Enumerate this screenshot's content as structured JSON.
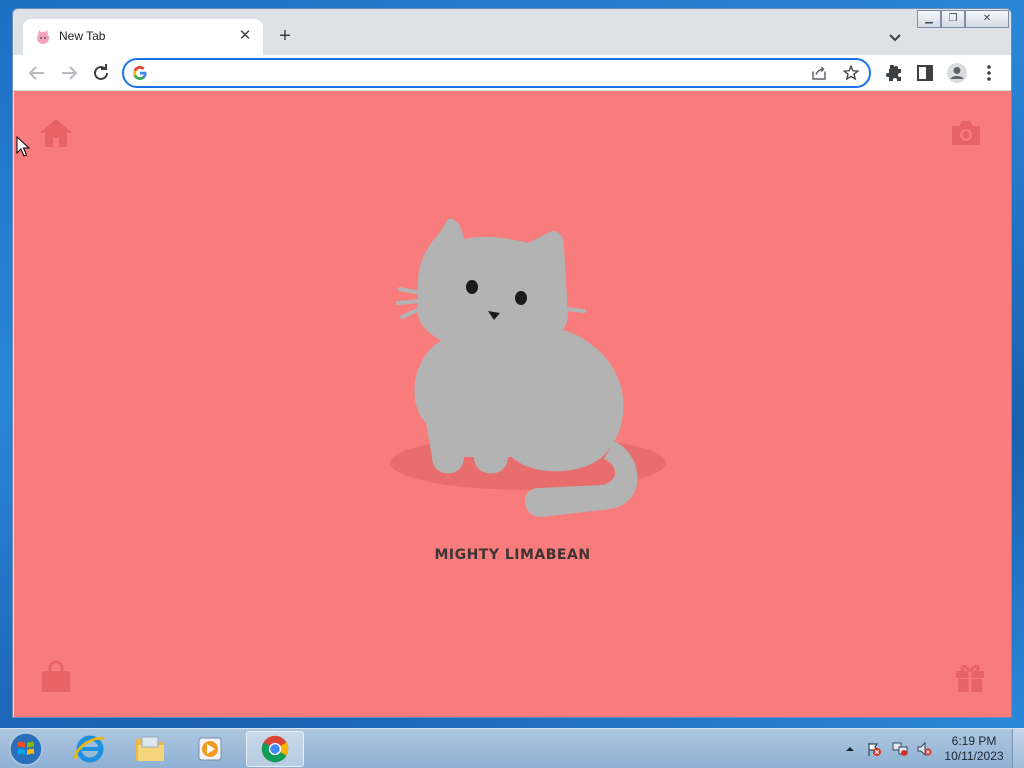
{
  "browser": {
    "tab": {
      "title": "New Tab",
      "favicon": "cat-icon"
    },
    "omnibox": {
      "value": "",
      "placeholder": ""
    }
  },
  "page": {
    "cat_name": "MIGHTY LIMABEAN",
    "background_color": "#f97c7c",
    "cat_color": "#b3b3b3",
    "corner_icons": [
      "home-icon",
      "camera-icon",
      "shopping-bag-icon",
      "gift-icon"
    ]
  },
  "taskbar": {
    "items": [
      "start-button",
      "internet-explorer",
      "file-explorer",
      "media-player",
      "google-chrome"
    ],
    "clock": {
      "time": "6:19 PM",
      "date": "10/11/2023"
    }
  }
}
